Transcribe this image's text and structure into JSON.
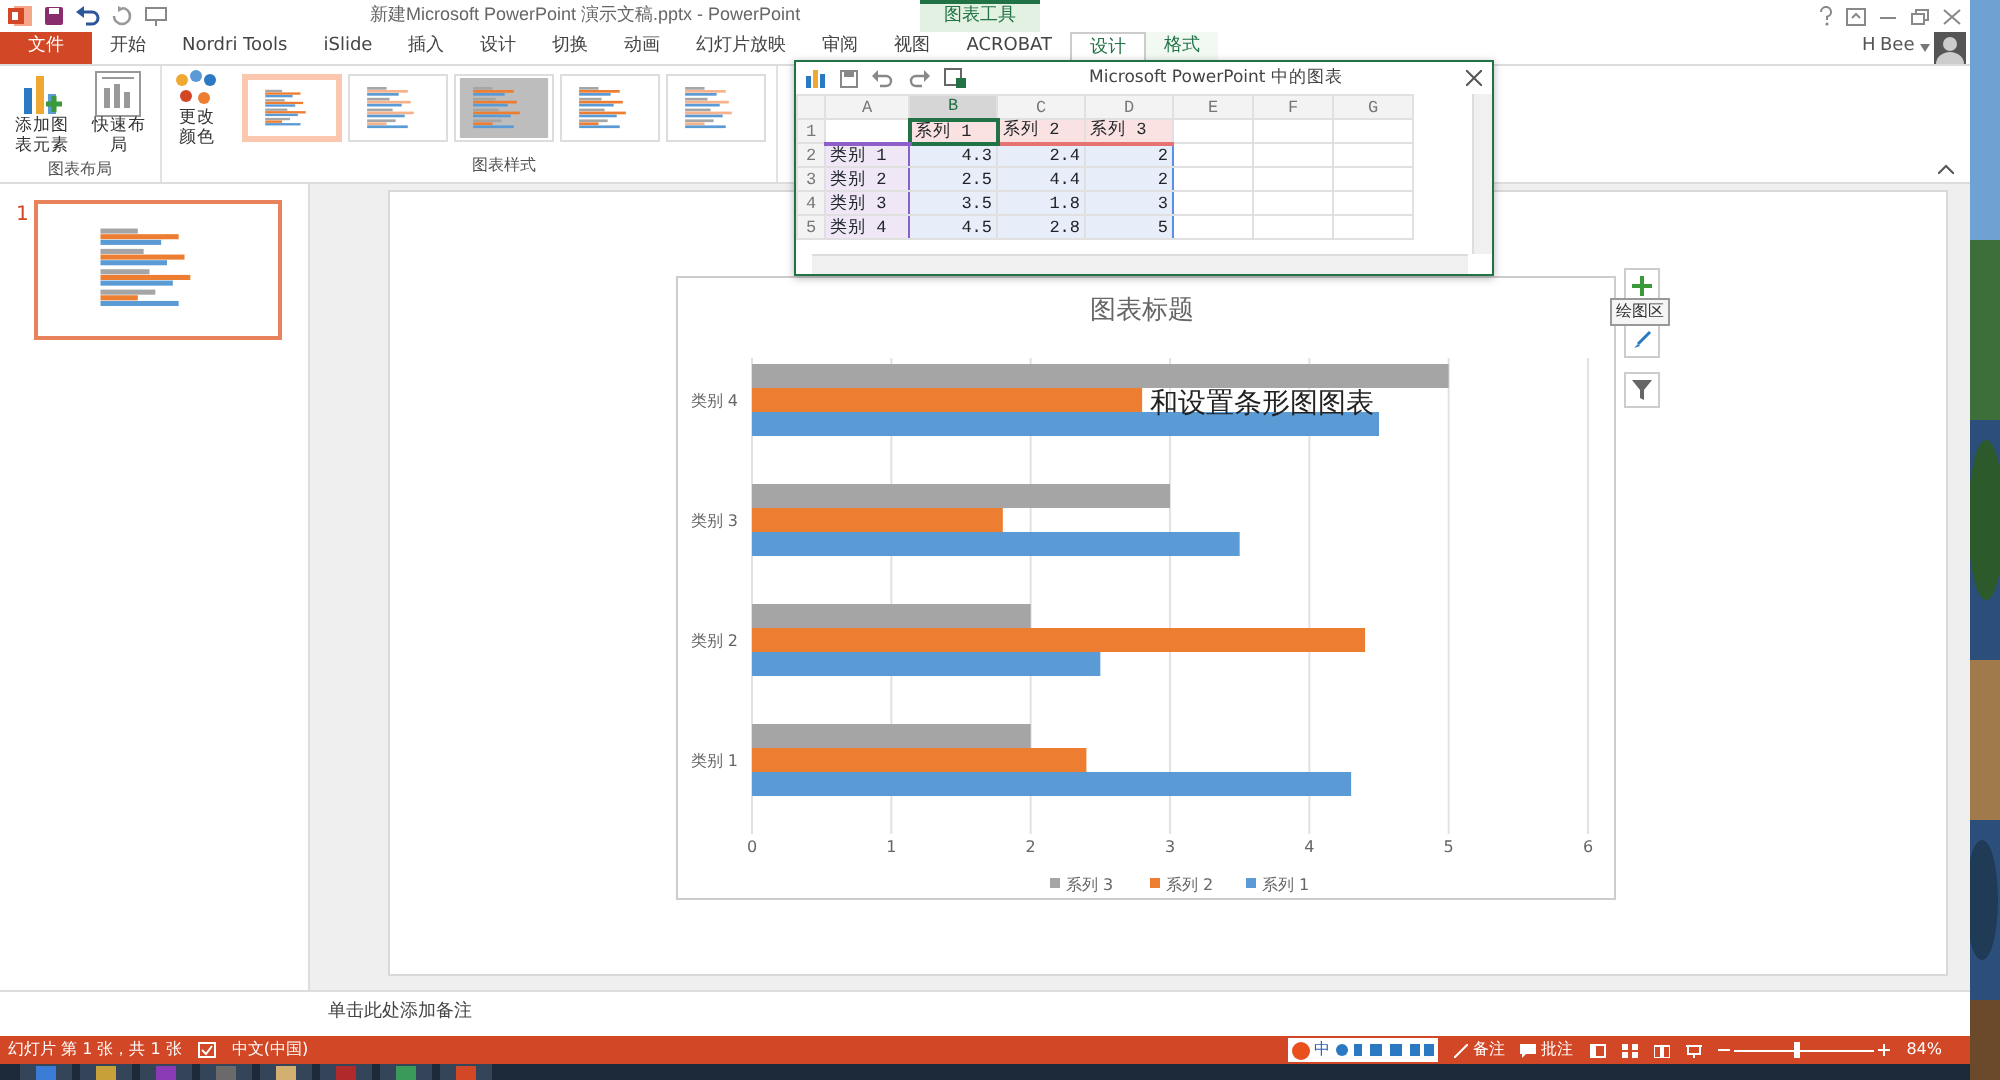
{
  "title_bar": {
    "title": "新建Microsoft PowerPoint 演示文稿.pptx - PowerPoint",
    "context_group": "图表工具",
    "user_initial": "H",
    "user_name": "Bee"
  },
  "tabs": [
    {
      "label": "文件",
      "kind": "file",
      "selected": false
    },
    {
      "label": "开始",
      "kind": "tab",
      "selected": false
    },
    {
      "label": "Nordri Tools",
      "kind": "tab",
      "selected": false
    },
    {
      "label": "iSlide",
      "kind": "tab",
      "selected": false
    },
    {
      "label": "插入",
      "kind": "tab",
      "selected": false
    },
    {
      "label": "设计",
      "kind": "tab",
      "selected": false
    },
    {
      "label": "切换",
      "kind": "tab",
      "selected": false
    },
    {
      "label": "动画",
      "kind": "tab",
      "selected": false
    },
    {
      "label": "幻灯片放映",
      "kind": "tab",
      "selected": false
    },
    {
      "label": "审阅",
      "kind": "tab",
      "selected": false
    },
    {
      "label": "视图",
      "kind": "tab",
      "selected": false
    },
    {
      "label": "ACROBAT",
      "kind": "tab",
      "selected": false
    },
    {
      "label": "设计",
      "kind": "context",
      "selected": true
    },
    {
      "label": "格式",
      "kind": "context",
      "selected": false
    }
  ],
  "ribbon": {
    "layout_group": {
      "label": "图表布局",
      "buttons": [
        {
          "label": "添加图表元素",
          "kind": "add"
        },
        {
          "label": "快速布局",
          "kind": "layout"
        }
      ]
    },
    "color_button": {
      "label": "更改颜色"
    },
    "styles_group": {
      "label": "图表样式",
      "styles": [
        {
          "selected": true
        },
        {
          "selected": false
        },
        {
          "selected": false
        },
        {
          "selected": false
        },
        {
          "selected": false
        }
      ]
    }
  },
  "thumbnails": [
    {
      "number": "1",
      "selected": true
    }
  ],
  "spreadsheet": {
    "title": "Microsoft PowerPoint 中的图表",
    "columns": [
      {
        "label": "A",
        "selected": false
      },
      {
        "label": "B",
        "selected": true
      },
      {
        "label": "C",
        "selected": false
      },
      {
        "label": "D",
        "selected": false
      },
      {
        "label": "E",
        "selected": false
      },
      {
        "label": "F",
        "selected": false
      },
      {
        "label": "G",
        "selected": false
      }
    ],
    "header_row": {
      "number": "1",
      "series": [
        "系列 1",
        "系列 2",
        "系列 3"
      ]
    },
    "rows": [
      {
        "number": "2",
        "category": "类别 1",
        "values": [
          "4.3",
          "2.4",
          "2"
        ]
      },
      {
        "number": "3",
        "category": "类别 2",
        "values": [
          "2.5",
          "4.4",
          "2"
        ]
      },
      {
        "number": "4",
        "category": "类别 3",
        "values": [
          "3.5",
          "1.8",
          "3"
        ]
      },
      {
        "number": "5",
        "category": "类别 4",
        "values": [
          "4.5",
          "2.8",
          "5"
        ]
      }
    ]
  },
  "chart": {
    "overlay_text": "和设置条形图图表",
    "tooltip": "绘图区",
    "chart_data": {
      "type": "bar",
      "orientation": "horizontal",
      "title": "图表标题",
      "categories": [
        "类别 4",
        "类别 3",
        "类别 2",
        "类别 1"
      ],
      "series": [
        {
          "name": "系列 1",
          "color": "#5b9bd5",
          "values": [
            4.5,
            3.5,
            2.5,
            4.3
          ]
        },
        {
          "name": "系列 2",
          "color": "#ed7d31",
          "values": [
            2.8,
            1.8,
            4.4,
            2.4
          ]
        },
        {
          "name": "系列 3",
          "color": "#a5a5a5",
          "values": [
            5,
            3,
            2,
            2
          ]
        }
      ],
      "xlim": [
        0,
        6
      ],
      "xticks": [
        0,
        1,
        2,
        3,
        4,
        5,
        6
      ],
      "grid": true,
      "legend": true
    }
  },
  "notes": {
    "placeholder": "单击此处添加备注"
  },
  "status_bar": {
    "slide_info": "幻灯片 第 1 张，共 1 张",
    "language": "中文(中国)",
    "ime": "中",
    "notes": "备注",
    "comments": "批注",
    "zoom": "84%",
    "zoom_slider": {
      "level": 0.45
    }
  }
}
